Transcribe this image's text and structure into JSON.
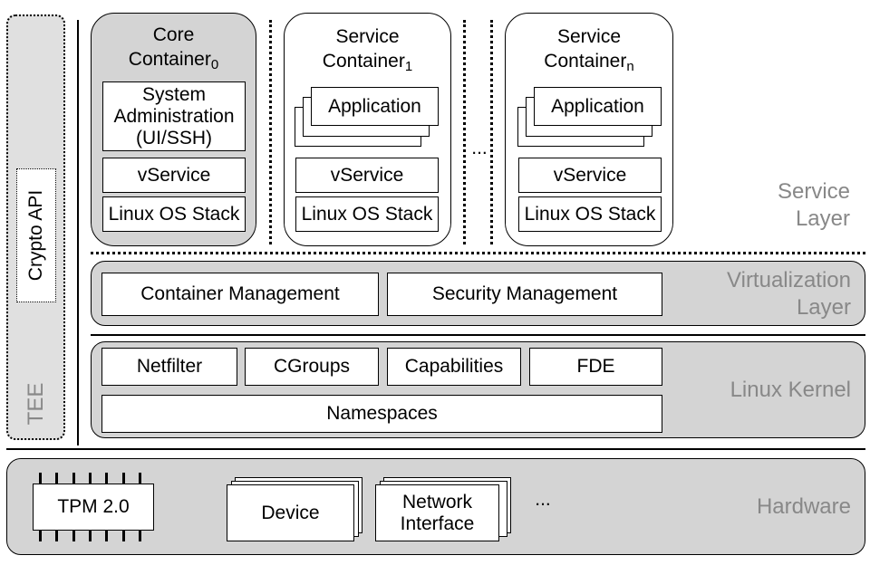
{
  "tee": {
    "label": "TEE",
    "crypto_api": "Crypto API"
  },
  "service_layer": {
    "label_line1": "Service",
    "label_line2": "Layer",
    "core_container": {
      "title": "Core",
      "title2": "Container",
      "sub": "0",
      "sys_admin": [
        "System",
        "Administration",
        "(UI/SSH)"
      ],
      "vservice": "vService",
      "os_stack": "Linux OS Stack"
    },
    "service_container_1": {
      "title": "Service",
      "title2": "Container",
      "sub": "1",
      "application": "Application",
      "vservice": "vService",
      "os_stack": "Linux OS Stack"
    },
    "ellipsis": "...",
    "service_container_n": {
      "title": "Service",
      "title2": "Container",
      "sub": "n",
      "application": "Application",
      "vservice": "vService",
      "os_stack": "Linux OS Stack"
    }
  },
  "virtualization_layer": {
    "label_line1": "Virtualization",
    "label_line2": "Layer",
    "container_management": "Container Management",
    "security_management": "Security Management"
  },
  "linux_kernel": {
    "label": "Linux Kernel",
    "netfilter": "Netfilter",
    "cgroups": "CGroups",
    "capabilities": "Capabilities",
    "fde": "FDE",
    "namespaces": "Namespaces"
  },
  "hardware": {
    "label": "Hardware",
    "tpm": "TPM 2.0",
    "device": "Device",
    "network_interface": [
      "Network",
      "Interface"
    ],
    "ellipsis": "..."
  },
  "colors": {
    "layer_fill": "#d4d4d4",
    "label_gray": "#888888"
  }
}
